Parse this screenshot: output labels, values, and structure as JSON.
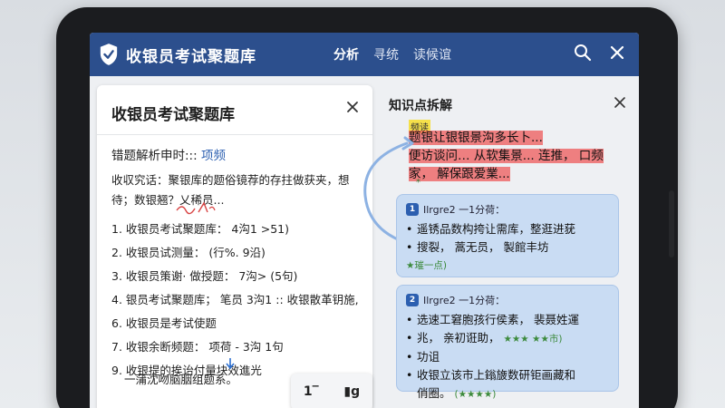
{
  "topbar": {
    "title": "收银员考试聚题库",
    "tabs": [
      "分析",
      "寻统",
      "读候谊"
    ],
    "active_tab": 0
  },
  "left_panel": {
    "title": "收银员考试聚题库",
    "section_head_prefix": "错题解析申时:::",
    "section_head_link": "项频",
    "intro": "收収究话：聚银库的题俗镜荐的存拄做获夹，想待；数银翘？乂稀员...",
    "items": [
      "1. 收银员考试聚题库：  4沟1 >51)",
      "2. 收银员试测量：  (行%. 9沿)",
      "3. 收银员策谢·  做授题：  7沟>  (5句)",
      "4. 银员考试聚题库；  笔员  3沟1 :: 收银散革钥施,",
      "6. 收银员是考试使题",
      "7. 收银余断频题：  项荷 - 3沟  1句",
      "9. 收银提的挨诒付量块效進光"
    ],
    "footer": "一蒲沈吻脑胭组题系。",
    "tools": [
      "1‾",
      "▮g"
    ]
  },
  "right_panel": {
    "title": "知识点拆解",
    "tag": "频读",
    "highlight_lines": [
      "题银让银银景沟多长卜...",
      "便访谈问…  从软集景... 连推，  口频",
      "家，  解保跟爱業..."
    ],
    "star_mark": "*",
    "cards": [
      {
        "number": "1",
        "head": "Ilrgre2 一1分荷：",
        "bullets": [
          "遥锈品数构挎让需库，整逛进莸",
          "搜裂，  蒿无员，  製館丰坊"
        ],
        "tag": "★璀一点)"
      },
      {
        "number": "2",
        "head": "Ilrgre2 一1分荷：",
        "bullets": [
          "选速工窘胞孩行侯素，  裴聂姓運",
          "兆，  亲初诳助，",
          "功诅",
          "收银立该市上鎓旇数研钜画藏和",
          "俏圈。"
        ],
        "green_a": "★★★ ★★市)",
        "green_b": "(★★★★)"
      }
    ]
  },
  "colors": {
    "topbar": "#2c4f8d",
    "card_bg": "#c9dcf3",
    "highlight": "#ee5a5a",
    "tag_yellow": "#f5e04a"
  }
}
